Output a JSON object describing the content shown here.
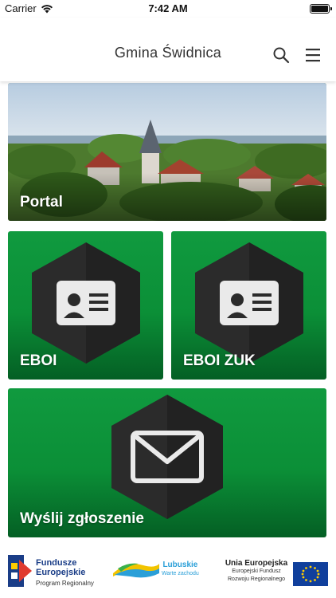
{
  "status_bar": {
    "carrier": "Carrier",
    "time": "7:42 AM"
  },
  "header": {
    "title": "Gmina Świdnica",
    "search_icon": "search-icon",
    "menu_icon": "hamburger-menu-icon"
  },
  "tiles": [
    {
      "label": "Portal",
      "icon": "town-photo"
    },
    {
      "label": "EBOI",
      "icon": "id-card-icon"
    },
    {
      "label": "EBOI ZUK",
      "icon": "id-card-icon"
    },
    {
      "label": "Wyślij zgłoszenie",
      "icon": "envelope-icon"
    }
  ],
  "footer": {
    "fe": {
      "line1": "Fundusze",
      "line2": "Europejskie",
      "line3": "Program Regionalny"
    },
    "lubuskie": {
      "line1": "Lubuskie",
      "line2": "Warte zachodu"
    },
    "ue": {
      "line1": "Unia Europejska",
      "line2": "Europejski Fundusz",
      "line3": "Rozwoju Regionalnego"
    }
  },
  "colors": {
    "tile_green": "#0b8f37",
    "tile_green_dark": "#045f24",
    "hex_dark": "#2b2b2b",
    "eu_blue": "#103f9c",
    "eu_star": "#ffcc00"
  }
}
